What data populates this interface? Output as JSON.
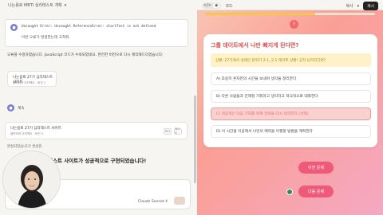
{
  "chat": {
    "title": "나는용로 MBTI 심리테스트 개획",
    "error_code": "Uncaught Error: Uncaught ReferenceError: startTest is not defined",
    "error_msg": "이런 오류가 발생한는데 고쳐줘.",
    "paragraph": "오류를 수정하였습니다. JavaScript 코드가 누락되었네요. 완전한 버전으로 다시 제작해드리겠습니다:",
    "artifact1": {
      "title": "나는용로 27기 심리테스트 사이트",
      "sub": "클릭하여 아티팩트 · 버전 2"
    },
    "answer_label": "계속",
    "artifact2": {
      "title": "나는용로 27기 심리테스트 사이트",
      "sub": "클릭하여 아티팩트 · 버전 3"
    },
    "copy_label": "복사",
    "retry_label": "재시도",
    "tiny_line": "완성되었습니다! 완성된",
    "bold_line": "테스트 사이트가 성공적으로 구현되었습니다!",
    "model": "Claude Sonnet 4"
  },
  "artifact_toolbar": {
    "code_label": "코드",
    "preview_label": "미리보기",
    "copy_label": "복사",
    "publish_label": "게시"
  },
  "quiz": {
    "step": "?",
    "progress": 0.65,
    "title": "그룹 데이트에서 나만 빠지게 된다면?",
    "scenario": "상황: 27기에서 설레인 분위기 2:1, 2:1 데이트 상황! 공자 남겨진다면?",
    "options": [
      "A) 조용히 혼자만의 시간을 보내며 생각을 정리한다",
      "B) 다른 사람들과 친해질 기회라고 생각하고 적극적으로 대화한다",
      "C) 적응적인 다음 기회를 위해 전략을 다시 생각한다 (선택)",
      "D) 이 시간을 이용해서 나만의 매력을 어필할 방법을 계획한다"
    ],
    "prev_label": "이전 문제",
    "next_label": "다음 문제"
  },
  "colors": {
    "accent": "#e24e4e",
    "selected_bg": "#fad1cf",
    "button": "#f05a7a",
    "progress": "#f4c64c"
  }
}
